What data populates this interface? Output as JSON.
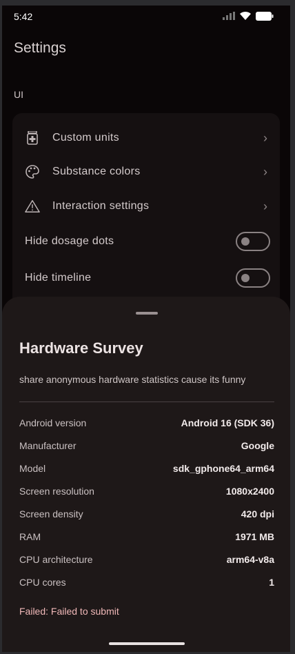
{
  "status_bar": {
    "time": "5:42"
  },
  "app_title": "Settings",
  "section": "UI",
  "settings": {
    "items": [
      {
        "label": "Custom units",
        "icon": "pill-bottle-icon"
      },
      {
        "label": "Substance colors",
        "icon": "palette-icon"
      },
      {
        "label": "Interaction settings",
        "icon": "warning-icon"
      }
    ],
    "toggles": [
      {
        "label": "Hide dosage dots",
        "on": false
      },
      {
        "label": "Hide timeline",
        "on": false
      }
    ]
  },
  "sheet": {
    "title": "Hardware Survey",
    "description": "share anonymous hardware statistics cause its funny",
    "rows": [
      {
        "key": "Android version",
        "value": "Android 16 (SDK 36)"
      },
      {
        "key": "Manufacturer",
        "value": "Google"
      },
      {
        "key": "Model",
        "value": "sdk_gphone64_arm64"
      },
      {
        "key": "Screen resolution",
        "value": "1080x2400"
      },
      {
        "key": "Screen density",
        "value": "420 dpi"
      },
      {
        "key": "RAM",
        "value": "1971 MB"
      },
      {
        "key": "CPU architecture",
        "value": "arm64-v8a"
      },
      {
        "key": "CPU cores",
        "value": "1"
      }
    ],
    "error": "Failed: Failed to submit"
  },
  "colors": {
    "background": "#0a0607",
    "card": "#151011",
    "sheet": "#1e1818",
    "error": "#f0b8b8"
  }
}
